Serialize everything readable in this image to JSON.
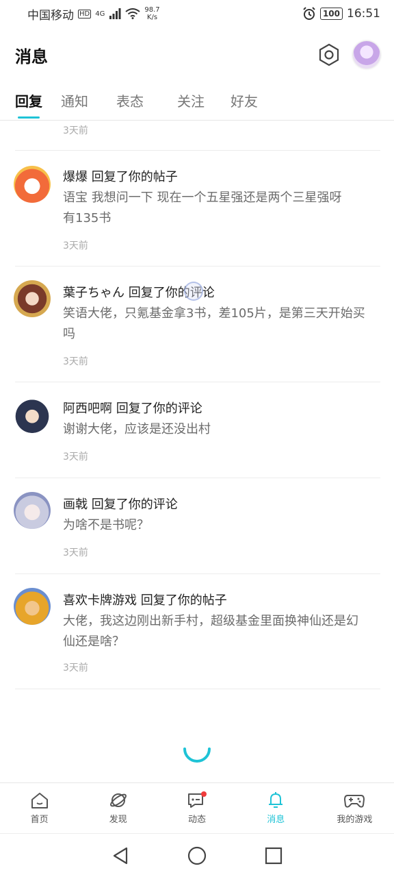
{
  "status_bar": {
    "carrier": "中国移动",
    "hd": "HD",
    "network": "4G",
    "speed_value": "98.7",
    "speed_unit": "K/s",
    "battery": "100",
    "time": "16:51"
  },
  "header": {
    "title": "消息"
  },
  "tabs": [
    {
      "label": "回复",
      "active": true
    },
    {
      "label": "通知",
      "active": false
    },
    {
      "label": "表态",
      "active": false
    },
    {
      "label": "关注",
      "active": false
    },
    {
      "label": "好友",
      "active": false
    }
  ],
  "top_item_time": "3天前",
  "messages": [
    {
      "title": "爆爆 回复了你的帖子",
      "body_lines": [
        "语宝  我想问一下  现在一个五星强还是两个三星强呀",
        " 有135书"
      ],
      "time": "3天前",
      "avatar_color": "#f26b3a"
    },
    {
      "title": "葉子ちゃん 回复了你的评论",
      "body_lines": [
        "笑语大佬，只氪基金拿3书，差105片，是第三天开始买",
        "吗"
      ],
      "time": "3天前",
      "avatar_color": "#7a3a2a"
    },
    {
      "title": "阿西吧啊 回复了你的评论",
      "body_lines": [
        "谢谢大佬，应该是还没出村"
      ],
      "time": "3天前",
      "avatar_color": "#2c3550"
    },
    {
      "title": "画戟 回复了你的评论",
      "body_lines": [
        "为啥不是书呢？"
      ],
      "time": "3天前",
      "avatar_color": "#c9cbe0"
    },
    {
      "title": "喜欢卡牌游戏 回复了你的帖子",
      "body_lines": [
        "大佬，我这边刚出新手村，超级基金里面换神仙还是幻",
        "仙还是啥？"
      ],
      "time": "3天前",
      "avatar_color": "#e7a52a"
    }
  ],
  "bottom_nav": [
    {
      "label": "首页",
      "icon": "home-icon",
      "active": false
    },
    {
      "label": "发现",
      "icon": "planet-icon",
      "active": false
    },
    {
      "label": "动态",
      "icon": "chat-icon",
      "active": false,
      "badge": true
    },
    {
      "label": "消息",
      "icon": "bell-icon",
      "active": true
    },
    {
      "label": "我的游戏",
      "icon": "gamepad-icon",
      "active": false
    }
  ],
  "colors": {
    "accent": "#1ec3d6",
    "badge": "#ef3b3b"
  }
}
